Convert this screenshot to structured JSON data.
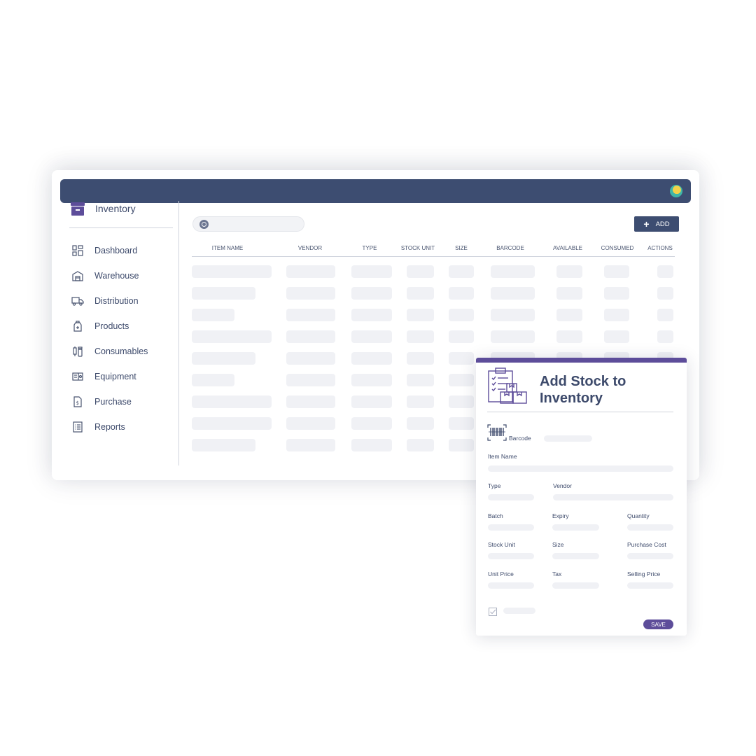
{
  "colors": {
    "topbar": "#3d4d71",
    "accent": "#5d4d9a",
    "placeholder": "#f0f1f5",
    "text": "#3d4a6b"
  },
  "sidebar": {
    "brand": {
      "label": "Inventory",
      "icon": "archive-box-icon"
    },
    "items": [
      {
        "label": "Dashboard",
        "icon": "dashboard-grid-icon"
      },
      {
        "label": "Warehouse",
        "icon": "warehouse-icon"
      },
      {
        "label": "Distribution",
        "icon": "truck-icon"
      },
      {
        "label": "Products",
        "icon": "bottle-icon"
      },
      {
        "label": "Consumables",
        "icon": "syringe-vial-icon"
      },
      {
        "label": "Equipment",
        "icon": "equipment-icon"
      },
      {
        "label": "Purchase",
        "icon": "invoice-dollar-icon"
      },
      {
        "label": "Reports",
        "icon": "list-report-icon"
      }
    ]
  },
  "toolbar": {
    "search_placeholder": "",
    "add_label": "ADD"
  },
  "table": {
    "columns": [
      "ITEM NAME",
      "VENDOR",
      "TYPE",
      "STOCK UNIT",
      "SIZE",
      "BARCODE",
      "AVAILABLE",
      "CONSUMED",
      "ACTIONS"
    ]
  },
  "modal": {
    "title": "Add Stock to Inventory",
    "fields": {
      "barcode": "Barcode",
      "item_name": "Item Name",
      "type": "Type",
      "vendor": "Vendor",
      "batch": "Batch",
      "expiry": "Expiry",
      "quantity": "Quantity",
      "stock_unit": "Stock Unit",
      "size": "Size",
      "purchase_cost": "Purchase Cost",
      "unit_price": "Unit Price",
      "tax": "Tax",
      "selling_price": "Selling Price"
    },
    "save_label": "SAVE"
  }
}
